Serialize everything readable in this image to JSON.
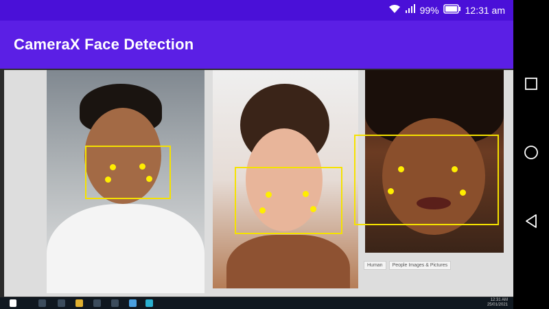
{
  "status_bar": {
    "battery": "99%",
    "time": "12:31 am",
    "wifi_icon": "wifi-icon",
    "signal_icon": "signal-icon",
    "battery_icon": "battery-icon"
  },
  "app_bar": {
    "title": "CameraX Face Detection"
  },
  "preview": {
    "tags": [
      "Human",
      "People Images & Pictures"
    ],
    "taskbar_clock": [
      "12:31 AM",
      "25/01/2021"
    ]
  },
  "nav_bar": {
    "recents_icon": "square-recents-icon",
    "home_icon": "circle-home-icon",
    "back_icon": "triangle-back-icon"
  },
  "colors": {
    "status_bar": "#4a10d8",
    "app_bar": "#5b1fe5",
    "detection": "#f5e200"
  }
}
